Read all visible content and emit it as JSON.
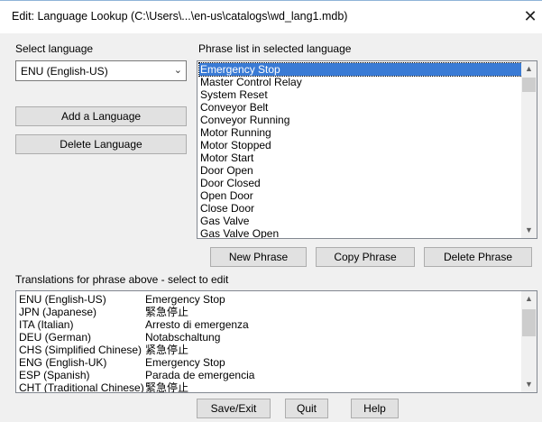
{
  "window": {
    "title": "Edit: Language Lookup (C:\\Users\\...\\en-us\\catalogs\\wd_lang1.mdb)",
    "close_glyph": "✕"
  },
  "language_panel": {
    "label": "Select language",
    "selected": "ENU (English-US)",
    "add_button": "Add a Language",
    "delete_button": "Delete Language"
  },
  "phrase_panel": {
    "label": "Phrase list in selected language",
    "phrases": [
      "Emergency Stop",
      "Master Control Relay",
      "System Reset",
      "Conveyor Belt",
      "Conveyor Running",
      "Motor Running",
      "Motor Stopped",
      "Motor Start",
      "Door Open",
      "Door Closed",
      "Open Door",
      "Close Door",
      "Gas Valve",
      "Gas Valve Open"
    ],
    "selected_index": 0,
    "new_button": "New Phrase",
    "copy_button": "Copy Phrase",
    "delete_button": "Delete Phrase"
  },
  "translations": {
    "label": "Translations for phrase above - select to edit",
    "rows": [
      {
        "language": "ENU (English-US)",
        "text": "Emergency Stop"
      },
      {
        "language": "JPN (Japanese)",
        "text": "緊急停止"
      },
      {
        "language": "ITA (Italian)",
        "text": "Arresto di emergenza"
      },
      {
        "language": "DEU (German)",
        "text": "Notabschaltung"
      },
      {
        "language": "CHS (Simplified Chinese)",
        "text": "紧急停止"
      },
      {
        "language": "ENG (English-UK)",
        "text": "Emergency Stop"
      },
      {
        "language": "ESP (Spanish)",
        "text": "Parada de emergencia"
      },
      {
        "language": "CHT (Traditional Chinese)",
        "text": "緊急停止"
      }
    ]
  },
  "footer": {
    "save_exit": "Save/Exit",
    "quit": "Quit",
    "help": "Help"
  }
}
